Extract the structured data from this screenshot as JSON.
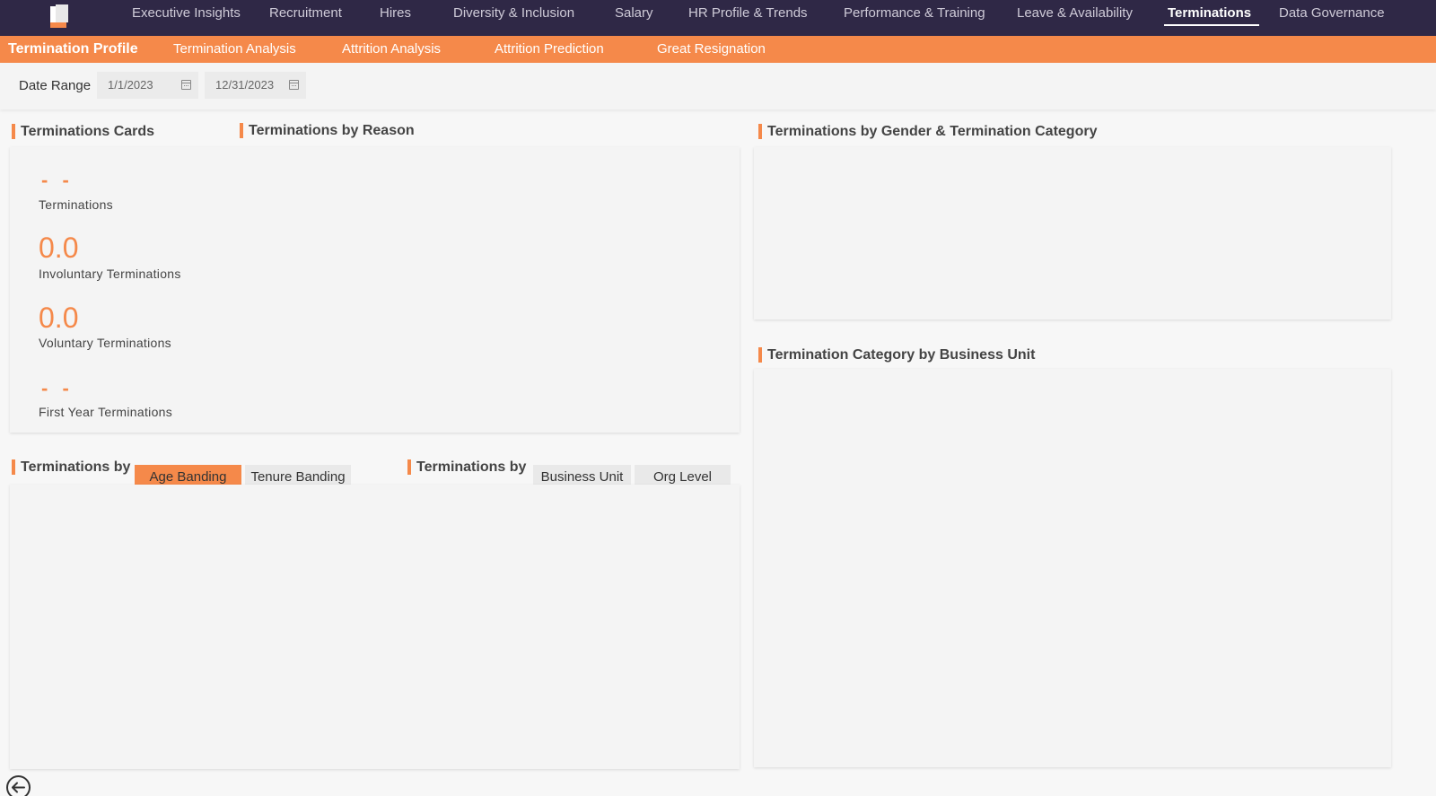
{
  "top_nav": {
    "items": [
      {
        "label": "Executive Insights"
      },
      {
        "label": "Recruitment"
      },
      {
        "label": "Hires"
      },
      {
        "label": "Diversity & Inclusion"
      },
      {
        "label": "Salary"
      },
      {
        "label": "HR Profile & Trends"
      },
      {
        "label": "Performance & Training"
      },
      {
        "label": "Leave & Availability"
      },
      {
        "label": "Terminations",
        "active": true
      },
      {
        "label": "Data Governance"
      }
    ]
  },
  "sub_nav": {
    "items": [
      {
        "label": "Termination Profile",
        "active": true
      },
      {
        "label": "Termination Analysis"
      },
      {
        "label": "Attrition Analysis"
      },
      {
        "label": "Attrition Prediction"
      },
      {
        "label": "Great Resignation"
      }
    ]
  },
  "filters": {
    "date_range_label": "Date Range",
    "start_date": "1/1/2023",
    "end_date": "12/31/2023"
  },
  "sections": {
    "cards_title": "Terminations Cards",
    "reason_title": "Terminations by Reason",
    "gender_category_title": "Terminations by Gender & Termination Category",
    "category_bu_title": "Termination Category by Business Unit",
    "by_banding_title": "Terminations by",
    "by_unit_title": "Terminations by"
  },
  "cards": {
    "terminations_value": "- -",
    "terminations_label": "Terminations",
    "involuntary_value": "0.0",
    "involuntary_label": "Involuntary Terminations",
    "voluntary_value": "0.0",
    "voluntary_label": "Voluntary Terminations",
    "first_year_value": "- -",
    "first_year_label": "First Year Terminations"
  },
  "toggles": {
    "age_banding": "Age Banding",
    "tenure_banding": "Tenure Banding",
    "business_unit": "Business Unit",
    "org_level": "Org Level",
    "active_banding": "Age Banding"
  },
  "colors": {
    "accent": "#f5894a",
    "nav_bg": "#2f2846"
  },
  "icons": {
    "logo": "brand-logo-icon",
    "calendar": "calendar-icon",
    "back": "back-arrow-icon"
  }
}
